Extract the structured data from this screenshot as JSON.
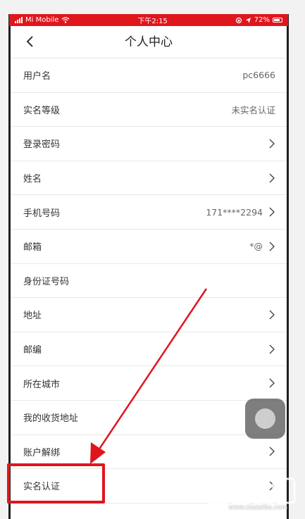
{
  "statusbar": {
    "carrier": "Mi Mobile",
    "time": "下午2:15",
    "battery": "72%",
    "color": "#e0161d"
  },
  "nav": {
    "title": "个人中心",
    "back_icon": "chevron-left-icon"
  },
  "rows": [
    {
      "label": "用户名",
      "value": "pc6666",
      "chevron": false
    },
    {
      "label": "实名等级",
      "value": "未实名认证",
      "chevron": false
    },
    {
      "label": "登录密码",
      "value": "",
      "chevron": true
    },
    {
      "label": "姓名",
      "value": "",
      "chevron": true
    },
    {
      "label": "手机号码",
      "value": "171****2294",
      "chevron": true
    },
    {
      "label": "邮箱",
      "value": "*@",
      "chevron": true
    },
    {
      "label": "身份证号码",
      "value": "",
      "chevron": false
    },
    {
      "label": "地址",
      "value": "",
      "chevron": true
    },
    {
      "label": "邮编",
      "value": "",
      "chevron": true
    },
    {
      "label": "所在城市",
      "value": "",
      "chevron": true
    },
    {
      "label": "我的收货地址",
      "value": "",
      "chevron": true
    },
    {
      "label": "账户解绑",
      "value": "",
      "chevron": true
    },
    {
      "label": "实名认证",
      "value": "",
      "chevron": true
    }
  ],
  "annotation": {
    "highlight_color": "#e0161d",
    "highlighted_item": "实名认证"
  },
  "watermark": {
    "domain": "www.xiazaiba.com"
  }
}
